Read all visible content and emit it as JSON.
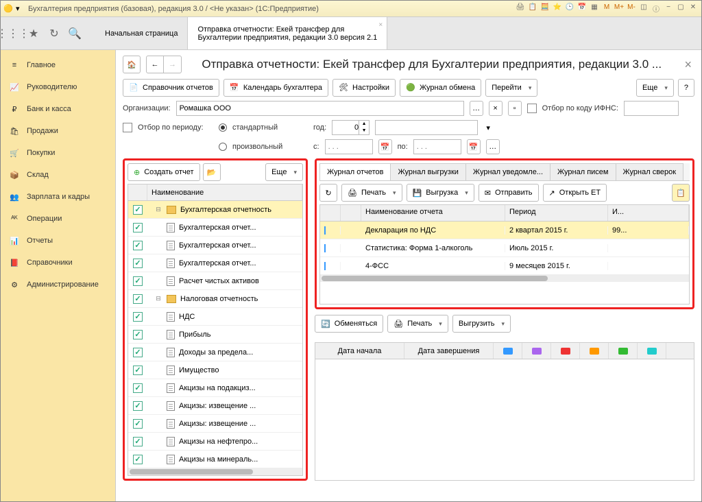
{
  "window": {
    "title": "Бухгалтерия предприятия (базовая), редакция 3.0 / <Не указан>   (1С:Предприятие)"
  },
  "tabs": {
    "home": "Начальная страница",
    "current_line1": "Отправка отчетности: Екей трансфер для",
    "current_line2": "Бухгалтерии предприятия, редакции 3.0 версия 2.1"
  },
  "sidebar": {
    "items": [
      {
        "icon": "menu",
        "label": "Главное"
      },
      {
        "icon": "chart",
        "label": "Руководителю"
      },
      {
        "icon": "bank",
        "label": "Банк и касса"
      },
      {
        "icon": "bag",
        "label": "Продажи"
      },
      {
        "icon": "cart",
        "label": "Покупки"
      },
      {
        "icon": "box",
        "label": "Склад"
      },
      {
        "icon": "people",
        "label": "Зарплата и кадры"
      },
      {
        "icon": "ops",
        "label": "Операции"
      },
      {
        "icon": "bars",
        "label": "Отчеты"
      },
      {
        "icon": "book",
        "label": "Справочники"
      },
      {
        "icon": "gear",
        "label": "Администрирование"
      }
    ]
  },
  "page": {
    "title": "Отправка отчетности: Екей трансфер для Бухгалтерии предприятия, редакции 3.0 ...",
    "toolbar": {
      "reports_ref": "Справочник отчетов",
      "calendar": "Календарь бухгалтера",
      "settings": "Настройки",
      "exchange_log": "Журнал обмена",
      "goto": "Перейти",
      "more": "Еще",
      "help": "?"
    },
    "filters": {
      "org_label": "Организации:",
      "org_value": "Ромашка ООО",
      "ifns_label": "Отбор по коду ИФНС:",
      "period_label": "Отбор по периоду:",
      "mode_std": "стандартный",
      "mode_custom": "произвольный",
      "year_label": "год:",
      "year_value": "0",
      "from_label": "с:",
      "to_label": "по:"
    }
  },
  "left": {
    "create": "Создать отчет",
    "more": "Еще",
    "header": "Наименование",
    "rows": [
      {
        "lvl": 0,
        "folder": true,
        "open": true,
        "sel": true,
        "label": "Бухгалтерская отчетность"
      },
      {
        "lvl": 1,
        "label": "Бухгалтерская отчет..."
      },
      {
        "lvl": 1,
        "label": "Бухгалтерская отчет..."
      },
      {
        "lvl": 1,
        "label": "Бухгалтерская отчет..."
      },
      {
        "lvl": 1,
        "label": "Расчет чистых активов"
      },
      {
        "lvl": 0,
        "folder": true,
        "open": true,
        "label": "Налоговая отчетность"
      },
      {
        "lvl": 1,
        "label": "НДС"
      },
      {
        "lvl": 1,
        "label": "Прибыль"
      },
      {
        "lvl": 1,
        "label": "Доходы за предела..."
      },
      {
        "lvl": 1,
        "label": "Имущество"
      },
      {
        "lvl": 1,
        "label": "Акцизы на подакциз..."
      },
      {
        "lvl": 1,
        "label": "Акцизы: извещение ..."
      },
      {
        "lvl": 1,
        "label": "Акцизы: извещение ..."
      },
      {
        "lvl": 1,
        "label": "Акцизы на нефтепро..."
      },
      {
        "lvl": 1,
        "label": "Акцизы на минераль..."
      }
    ]
  },
  "right": {
    "tabs": [
      "Журнал отчетов",
      "Журнал выгрузки",
      "Журнал уведомле...",
      "Журнал писем",
      "Журнал сверок"
    ],
    "toolbar": {
      "print": "Печать",
      "export": "Выгрузка",
      "send": "Отправить",
      "open_et": "Открыть ЕТ"
    },
    "columns": {
      "name": "Наименование отчета",
      "period": "Период",
      "extra": "И..."
    },
    "rows": [
      {
        "sel": true,
        "name": "Декларация по НДС",
        "period": "2 квартал 2015 г.",
        "extra": "99..."
      },
      {
        "name": "Статистика: Форма 1-алкоголь",
        "period": "Июль 2015 г.",
        "extra": ""
      },
      {
        "name": "4-ФСС",
        "period": "9 месяцев 2015 г.",
        "extra": ""
      }
    ]
  },
  "lower": {
    "exchange": "Обменяться",
    "print": "Печать",
    "export": "Выгрузить",
    "columns": {
      "start": "Дата начала",
      "end": "Дата завершения"
    }
  }
}
